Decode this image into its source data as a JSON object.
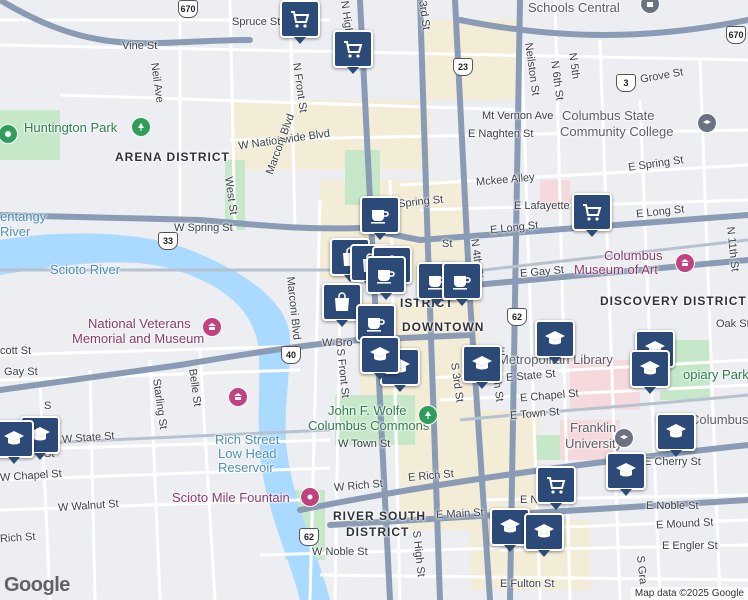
{
  "districts": {
    "arena": "ARENA DISTRICT",
    "downtown": "DOWNTOWN",
    "discovery": "DISCOVERY DISTRICT",
    "river_south_1": "RIVER SOUTH",
    "river_south_2": "DISTRICT"
  },
  "places": {
    "huntington_park": "Huntington Park",
    "cscc_1": "Columbus State",
    "cscc_2": "Community College",
    "museum_1": "Columbus",
    "museum_2": "Museum of Art",
    "veterans_1": "National Veterans",
    "veterans_2": "Memorial and Museum",
    "library": "Metropolitan Library",
    "wolfe_1": "John F. Wolfe",
    "wolfe_2": "Columbus Commons",
    "rich_res_1": "Rich Street",
    "rich_res_2": "Low Head",
    "rich_res_3": "Reservoir",
    "franklin_1": "Franklin",
    "franklin_2": "University",
    "scioto_mile": "Scioto Mile Fountain",
    "schools_central": "Schools Central",
    "topiary": "opiary Park",
    "columbus_edge": "Columbus",
    "olentangy_1": "entangy",
    "olentangy_2": "River",
    "scioto_river": "Scioto River"
  },
  "streets": {
    "spruce": "Spruce St",
    "vine": "Vine St",
    "neil": "Neil Ave",
    "nfront": "N Front St",
    "nhigh": "N High",
    "n3rd": "3rd St",
    "nelston": "Neilston St",
    "n5th": "N 5th",
    "n6th": "N 6th St",
    "grove": "Grove St",
    "mtvernon": "Mt Vernon Ave",
    "naghten": "E Naghten St",
    "nationwide": "W Nationwide Blvd",
    "marconi_n": "Marconi Blvd",
    "west": "West St",
    "mckee": "Mckee Alley",
    "espring": "E Spring St",
    "wspring": "W Spring St",
    "spring_mid": "Spring St",
    "lafayette": "E Lafayette",
    "elong": "E Long St",
    "elong2": "E Long St",
    "n4th": "N 4th St",
    "egay": "E Gay St",
    "marconi_s": "Marconi Blvd",
    "oak": "Oak St",
    "wbroad": "W Bro",
    "sfront": "S Front St",
    "scott": "cott St",
    "gay_w": "Gay St",
    "starling": "Starling St",
    "belle": "Belle St",
    "s3rd": "S 3rd St",
    "s4th": "S 4th St",
    "estate": "E State St",
    "echapel": "E Chapel St",
    "wstate": "W State St",
    "wtown": "W Town St",
    "etown": "E Town St",
    "echerry": "E Cherry St",
    "wchapel": "W Chapel St",
    "wwalnut": "W Walnut St",
    "wrich": "W Rich St",
    "erich": "E Rich St",
    "rich_w": "Rich St",
    "emain": "E Main St",
    "enoble": "E Noble St",
    "emound": "E Mound St",
    "eengler": "E Engler St",
    "wnoble": "W Noble St",
    "shigh": "S High St",
    "sgra": "S Gra",
    "efulton": "E Fulton St",
    "n11th": "N 11th St",
    "s_st": "S",
    "st_frag": "St",
    "enoble_frag": "E N",
    "e_frag": "E",
    "istrict": "ISTRICT",
    "st_mid": "St"
  },
  "highways": {
    "i670_top": "670",
    "i670_right": "670",
    "us23": "23",
    "sr3": "3",
    "us33": "33",
    "us62_east": "62",
    "i40": "40",
    "us62_south": "62"
  },
  "markers": [
    {
      "type": "shopping-cart",
      "label": "grocery"
    },
    {
      "type": "shopping-cart",
      "label": "grocery"
    },
    {
      "type": "coffee",
      "label": "cafe"
    },
    {
      "type": "shopping-cart",
      "label": "grocery"
    },
    {
      "type": "shopping-bag",
      "label": "shop"
    },
    {
      "type": "shopping-bag",
      "label": "shop"
    },
    {
      "type": "shopping-bag",
      "label": "shop"
    },
    {
      "type": "coffee",
      "label": "cafe"
    },
    {
      "type": "coffee",
      "label": "cafe"
    },
    {
      "type": "shopping-bag",
      "label": "shop"
    },
    {
      "type": "coffee",
      "label": "cafe"
    },
    {
      "type": "coffee",
      "label": "cafe"
    },
    {
      "type": "school",
      "label": "school"
    },
    {
      "type": "school",
      "label": "school"
    },
    {
      "type": "school",
      "label": "school"
    },
    {
      "type": "school",
      "label": "school"
    },
    {
      "type": "school",
      "label": "school"
    },
    {
      "type": "school",
      "label": "school"
    },
    {
      "type": "school",
      "label": "school"
    },
    {
      "type": "school",
      "label": "school"
    },
    {
      "type": "school",
      "label": "school"
    },
    {
      "type": "shopping-cart",
      "label": "grocery"
    },
    {
      "type": "school",
      "label": "school"
    },
    {
      "type": "school",
      "label": "school"
    },
    {
      "type": "school",
      "label": "school"
    }
  ],
  "footer": {
    "logo": "Google",
    "attribution": "Map data ©2025 Google"
  },
  "colors": {
    "water": "#aadaff",
    "park": "#c4e6c8",
    "major_road": "#8a9bb5",
    "marker": "#2c4a78",
    "downtown_fill": "#f3ecd7"
  }
}
